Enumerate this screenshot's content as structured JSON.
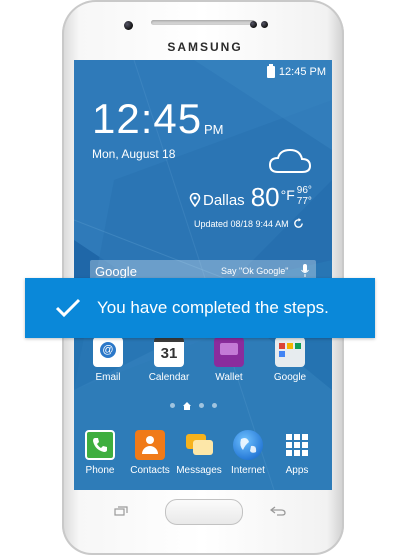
{
  "device": {
    "brand": "SAMSUNG"
  },
  "status_bar": {
    "time": "12:45 PM"
  },
  "lock_clock": {
    "time": "12:45",
    "ampm": "PM",
    "date": "Mon, August 18"
  },
  "weather": {
    "city": "Dallas",
    "temp": "80",
    "unit": "°F",
    "high": "96°",
    "low": "77°",
    "updated": "Updated 08/18 9:44 AM"
  },
  "search": {
    "logo": "Google",
    "hint": "Say \"Ok Google\""
  },
  "apps_row": [
    {
      "label": "Email",
      "icon": "email-icon"
    },
    {
      "label": "Calendar",
      "icon": "calendar-icon",
      "badge": "31"
    },
    {
      "label": "Wallet",
      "icon": "wallet-icon"
    },
    {
      "label": "Google",
      "icon": "google-folder-icon"
    }
  ],
  "dock": [
    {
      "label": "Phone",
      "icon": "phone-icon"
    },
    {
      "label": "Contacts",
      "icon": "contacts-icon"
    },
    {
      "label": "Messages",
      "icon": "messages-icon"
    },
    {
      "label": "Internet",
      "icon": "globe-icon"
    },
    {
      "label": "Apps",
      "icon": "apps-grid-icon"
    }
  ],
  "banner": {
    "text": "You have completed the steps."
  },
  "colors": {
    "banner": "#0a88d9",
    "screen": "#1f67a8"
  }
}
